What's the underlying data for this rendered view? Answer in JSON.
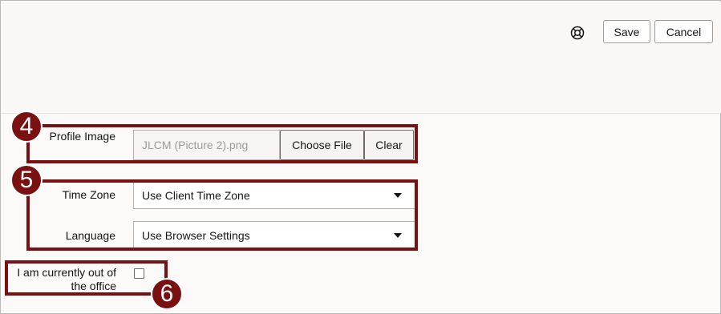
{
  "header": {
    "help_icon": "help-lifebuoy-icon",
    "save_label": "Save",
    "cancel_label": "Cancel"
  },
  "profile_image": {
    "label": "Profile Image",
    "file_name": "JLCM (Picture 2).png",
    "choose_label": "Choose File",
    "clear_label": "Clear"
  },
  "time_zone": {
    "label": "Time Zone",
    "selected": "Use Client Time Zone"
  },
  "language": {
    "label": "Language",
    "selected": "Use Browser Settings"
  },
  "out_of_office": {
    "label_line1": "I am currently out of",
    "label_line2": "the office",
    "checked": false
  },
  "callouts": {
    "badge_4": "4",
    "badge_5": "5",
    "badge_6": "6",
    "highlight_color": "#7b1010"
  }
}
